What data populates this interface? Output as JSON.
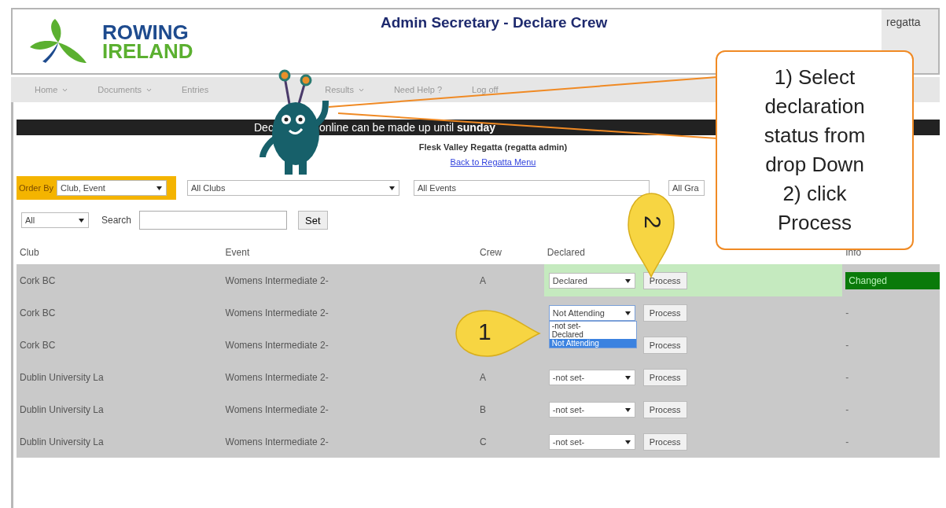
{
  "header": {
    "logo_top": "ROWING",
    "logo_bottom": "IRELAND",
    "title": "Admin Secretary - Declare Crew",
    "user": "regatta"
  },
  "nav": [
    {
      "label": "Home",
      "has_menu": true
    },
    {
      "label": "Documents",
      "has_menu": true
    },
    {
      "label": "Entries",
      "has_menu": false
    },
    {
      "label": "Results",
      "has_menu": true
    },
    {
      "label": "Need Help ?",
      "has_menu": false
    },
    {
      "label": "Log off",
      "has_menu": false
    }
  ],
  "banner": {
    "start": "Dec",
    "rest": "online can be made up until **sunday**"
  },
  "regatta": {
    "name": "Flesk Valley Regatta (regatta admin)",
    "back_link": "Back to Regatta Menu"
  },
  "filters": {
    "order_label": "Order By",
    "order_value": "Club, Event",
    "club": "All Clubs",
    "event": "All Events",
    "grade": "All Gra",
    "status": "All",
    "search_label": "Search",
    "set_button": "Set"
  },
  "table": {
    "columns": [
      "Club",
      "Event",
      "Crew",
      "Declared",
      "Info"
    ],
    "rows": [
      {
        "club": "Cork BC",
        "event": "Womens Intermediate 2-",
        "crew": "A",
        "declared": "Declared",
        "process": "Process",
        "info": "Changed",
        "changed": true
      },
      {
        "club": "Cork BC",
        "event": "Womens Intermediate 2-",
        "declared": "Not Attending",
        "process": "Process",
        "info": "-",
        "changed": false,
        "options": [
          {
            "label": "-not set-",
            "selected": false
          },
          {
            "label": "Declared",
            "selected": false
          },
          {
            "label": "Not Attending",
            "selected": true
          }
        ]
      },
      {
        "club": "Cork BC",
        "event": "Womens Intermediate 2-",
        "process": "Process",
        "info": "-",
        "changed": false
      },
      {
        "club": "Dublin University La",
        "event": "Womens Intermediate 2-",
        "crew": "A",
        "declared": "-not set-",
        "process": "Process",
        "info": "-",
        "changed": false
      },
      {
        "club": "Dublin University La",
        "event": "Womens Intermediate 2-",
        "crew": "B",
        "declared": "-not set-",
        "process": "Process",
        "info": "-",
        "changed": false
      },
      {
        "club": "Dublin University La",
        "event": "Womens Intermediate 2-",
        "crew": "C",
        "declared": "-not set-",
        "process": "Process",
        "info": "-",
        "changed": false
      }
    ]
  },
  "callout": {
    "steps": [
      "1) Select declaration status from drop Down",
      "2) click Process"
    ]
  },
  "pins": [
    {
      "label": "1",
      "kind": "right"
    },
    {
      "label": "2",
      "kind": "down"
    }
  ]
}
